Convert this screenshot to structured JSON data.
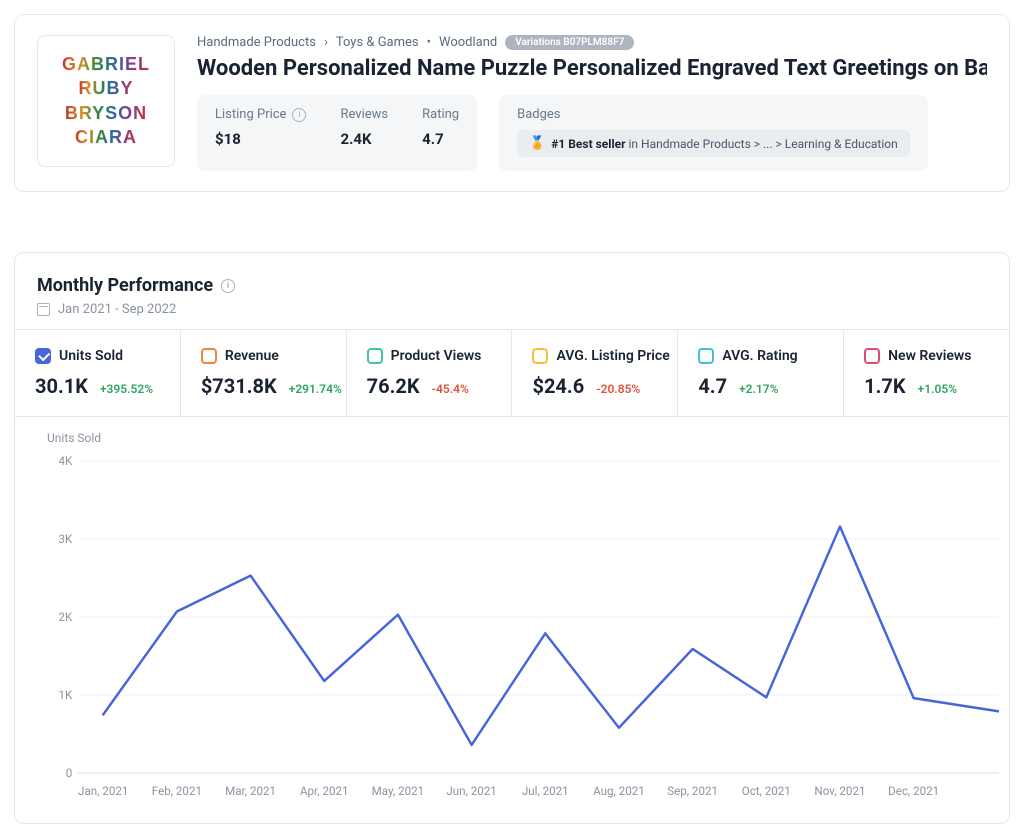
{
  "product": {
    "breadcrumb": [
      "Handmade Products",
      "Toys & Games"
    ],
    "brand": "Woodland",
    "variations_label": "Variations B07PLM88F7",
    "title": "Wooden Personalized Name Puzzle Personalized Engraved Text Greetings on Back Gift for Baby Boy",
    "thumb_words": [
      "GABRIEL",
      "RUBY",
      "BRYSON",
      "CIARA"
    ],
    "stats": {
      "listing_price": {
        "label": "Listing Price",
        "value": "$18"
      },
      "reviews": {
        "label": "Reviews",
        "value": "2.4K"
      },
      "rating": {
        "label": "Rating",
        "value": "4.7"
      }
    },
    "badges": {
      "label": "Badges",
      "rank": "#1 Best seller",
      "in_text": "in Handmade Products > ... > Learning & Education"
    }
  },
  "performance": {
    "title": "Monthly Performance",
    "range": "Jan 2021 - Sep 2022",
    "metrics": [
      {
        "id": "units",
        "label": "Units Sold",
        "value": "30.1K",
        "delta": "+395.52%",
        "delta_dir": "pos",
        "color": "#4565d8",
        "checked": true
      },
      {
        "id": "rev",
        "label": "Revenue",
        "value": "$731.8K",
        "delta": "+291.74%",
        "delta_dir": "pos",
        "color": "#f0883a",
        "checked": false
      },
      {
        "id": "views",
        "label": "Product Views",
        "value": "76.2K",
        "delta": "-45.4%",
        "delta_dir": "neg",
        "color": "#3fc3a4",
        "checked": false
      },
      {
        "id": "price",
        "label": "AVG. Listing Price",
        "value": "$24.6",
        "delta": "-20.85%",
        "delta_dir": "neg",
        "color": "#f2c23c",
        "checked": false
      },
      {
        "id": "rating",
        "label": "AVG. Rating",
        "value": "4.7",
        "delta": "+2.17%",
        "delta_dir": "pos",
        "color": "#3fc3d9",
        "checked": false
      },
      {
        "id": "newrev",
        "label": "New Reviews",
        "value": "1.7K",
        "delta": "+1.05%",
        "delta_dir": "pos",
        "color": "#e34a6f",
        "checked": false
      }
    ]
  },
  "chart_data": {
    "type": "line",
    "title": "",
    "ylabel": "Units Sold",
    "xlabel": "",
    "ylim": [
      0,
      4000
    ],
    "yticks": [
      0,
      1000,
      2000,
      3000,
      4000
    ],
    "ytick_labels": [
      "0",
      "1K",
      "2K",
      "3K",
      "4K"
    ],
    "categories": [
      "Jan, 2021",
      "Feb, 2021",
      "Mar, 2021",
      "Apr, 2021",
      "May, 2021",
      "Jun, 2021",
      "Jul, 2021",
      "Aug, 2021",
      "Sep, 2021",
      "Oct, 2021",
      "Nov, 2021",
      "Dec, 2021"
    ],
    "series": [
      {
        "name": "Units Sold",
        "values": [
          750,
          2070,
          2530,
          1180,
          2030,
          360,
          1790,
          580,
          1590,
          970,
          3160,
          960
        ],
        "trailing_value": 790
      }
    ]
  }
}
